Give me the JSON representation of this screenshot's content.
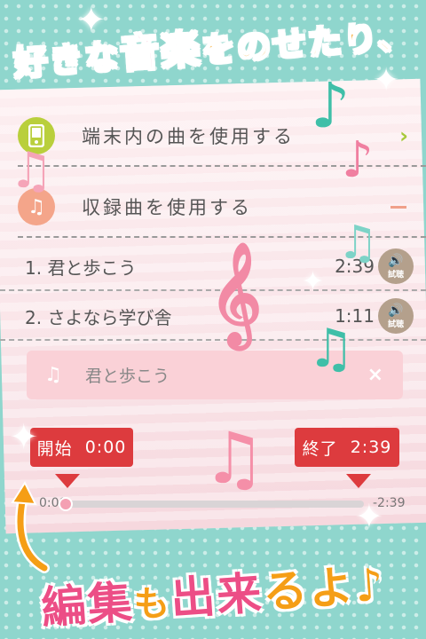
{
  "headline_top": {
    "part1": "好きな",
    "part2": "音楽",
    "part3": "をのせたり、"
  },
  "headline_bottom": {
    "part1": "編集",
    "part2": "も",
    "part3": "出来",
    "part4": "るよ♪"
  },
  "menu": [
    {
      "label": "端末内の曲を使用する",
      "icon": "phone-icon",
      "icon_color": "#b9cf3c"
    },
    {
      "label": "収録曲を使用する",
      "icon": "music-note-icon",
      "icon_color": "#f4a58a"
    }
  ],
  "songs": [
    {
      "number": "1.",
      "title": "君と歩こう",
      "duration": "2:39",
      "listen_label": "試聴"
    },
    {
      "number": "2.",
      "title": "さよなら学び舎",
      "duration": "1:11",
      "listen_label": "試聴"
    }
  ],
  "selected": {
    "title": "君と歩こう",
    "note_glyph": "♫",
    "close_glyph": "×"
  },
  "editor": {
    "start_label": "開始",
    "start_time": "0:00",
    "end_label": "終了",
    "end_time": "2:39",
    "track_start": "0:00",
    "track_remaining": "-2:39"
  },
  "colors": {
    "accent_red": "#dd3b3e",
    "pink": "#ec4e86",
    "orange": "#f59e16",
    "teal": "#8fd6cd"
  }
}
